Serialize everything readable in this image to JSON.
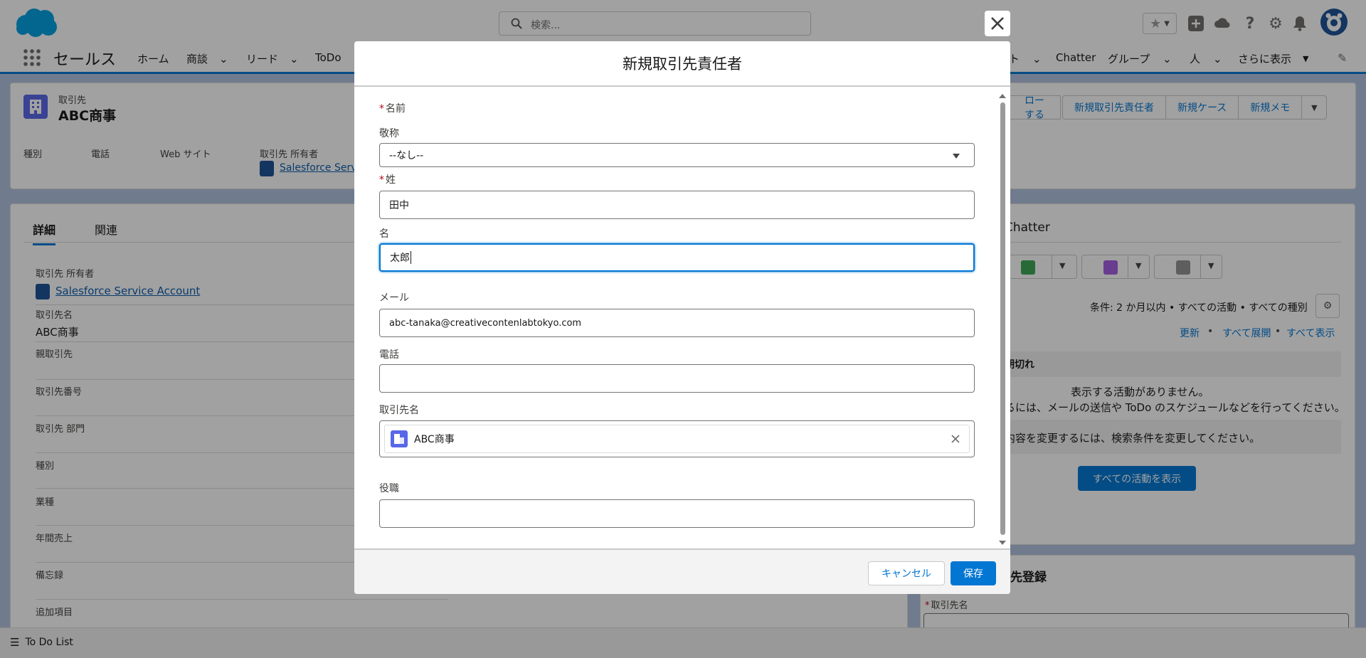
{
  "header": {
    "search_placeholder": "検索...",
    "app_name": "セールス",
    "nav_items": [
      "ホーム",
      "商談",
      "リード",
      "ToDo",
      "ト",
      "Chatter",
      "グループ",
      "人",
      "さらに表示"
    ]
  },
  "record": {
    "type_label": "取引先",
    "title": "ABC商事",
    "highlights": [
      "種別",
      "電話",
      "Web サイト",
      "取引先 所有者"
    ],
    "owner_truncated": "Salesforce Servi",
    "actions": [
      "ローする",
      "新規取引先責任者",
      "新規ケース",
      "新規メモ"
    ]
  },
  "detail": {
    "tabs": [
      "詳細",
      "関連"
    ],
    "fields": [
      {
        "label": "取引先 所有者",
        "value": "Salesforce Service Account"
      },
      {
        "label": "取引先名",
        "value": "ABC商事"
      },
      {
        "label": "親取引先",
        "value": ""
      },
      {
        "label": "取引先番号",
        "value": ""
      },
      {
        "label": "取引先 部門",
        "value": ""
      },
      {
        "label": "種別",
        "value": ""
      },
      {
        "label": "業種",
        "value": ""
      },
      {
        "label": "年間売上",
        "value": ""
      },
      {
        "label": "備忘録",
        "value": ""
      },
      {
        "label": "追加項目",
        "value": ""
      }
    ]
  },
  "activity": {
    "title": "Chatter",
    "filter_text": "条件: 2 か月以内 • すべての活動 • すべての種別",
    "links": [
      "更新",
      "すべて展開",
      "すべて表示"
    ],
    "section_label": "期切れ",
    "empty_line1": "表示する活動がありません。",
    "empty_line2": "るには、メールの送信や ToDo のスケジュールなどを行ってください。",
    "filter_note": "内容を変更するには、検索条件を変更してください。",
    "show_all_button": "すべての活動を表示"
  },
  "quick_card": {
    "title": "先登録",
    "field_label": "取引先名"
  },
  "todo_bar": {
    "label": "To Do List"
  },
  "modal": {
    "title": "新規取引先責任者",
    "name_section_label": "名前",
    "salutation_label": "敬称",
    "salutation_value": "--なし--",
    "last_name_label": "姓",
    "last_name_value": "田中",
    "first_name_label": "名",
    "first_name_value": "太郎",
    "email_label": "メール",
    "email_value": "abc-tanaka@creativecontenlabtokyo.com",
    "phone_label": "電話",
    "phone_value": "",
    "account_label": "取引先名",
    "account_value": "ABC商事",
    "title_label": "役職",
    "title_value": "",
    "cancel_label": "キャンセル",
    "save_label": "保存"
  },
  "colors": {
    "brand": "#0176d3",
    "account_icon": "#5867e8",
    "required": "#ba0517"
  }
}
